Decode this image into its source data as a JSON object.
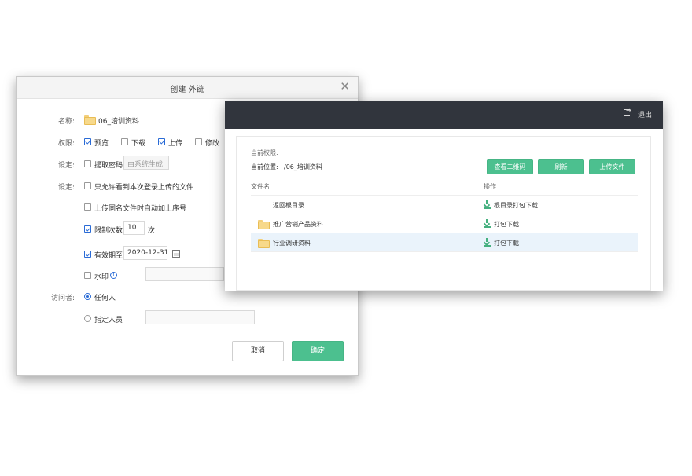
{
  "dialog": {
    "title": "创建 外链",
    "close_glyph": "✕",
    "name_label": "名称:",
    "name_value": "06_培训资料",
    "permission_label": "权限:",
    "permissions": [
      {
        "label": "预览",
        "checked": true
      },
      {
        "label": "下载",
        "checked": false
      },
      {
        "label": "上传",
        "checked": true
      },
      {
        "label": "修改",
        "checked": false
      }
    ],
    "setting_label_1": "设定:",
    "password_label": "提取密码",
    "password_placeholder": "由系统生成",
    "setting_label_2": "设定:",
    "only_own_uploads_label": "只允许看到本次登录上传的文件",
    "auto_sequence_label": "上传同名文件时自动加上序号",
    "limit_count_label": "限制次数",
    "limit_count_value": "10",
    "limit_count_unit": "次",
    "expiry_label": "有效期至",
    "expiry_value": "2020-12-31",
    "watermark_label": "水印",
    "visitor_label": "访问者:",
    "visitor_anyone": "任何人",
    "visitor_specific": "指定人员",
    "cancel_label": "取消",
    "confirm_label": "确定"
  },
  "browser": {
    "logout_label": "退出",
    "current_permission_label": "当前权限:",
    "current_location_label": "当前位置:",
    "current_location_value": "/06_培训资料",
    "buttons": {
      "qrcode": "查看二维码",
      "refresh": "刷新",
      "upload": "上传文件"
    },
    "columns": {
      "name": "文件名",
      "action": "操作"
    },
    "rows": [
      {
        "name": "返回根目录",
        "action": "根目录打包下载"
      },
      {
        "name": "推广营销产品资料",
        "action": "打包下载"
      },
      {
        "name": "行业调研资料",
        "action": "打包下载"
      }
    ]
  },
  "colors": {
    "accent_green": "#4cc08f",
    "topbar": "#31353d",
    "checkbox_blue": "#2a6bd6"
  }
}
